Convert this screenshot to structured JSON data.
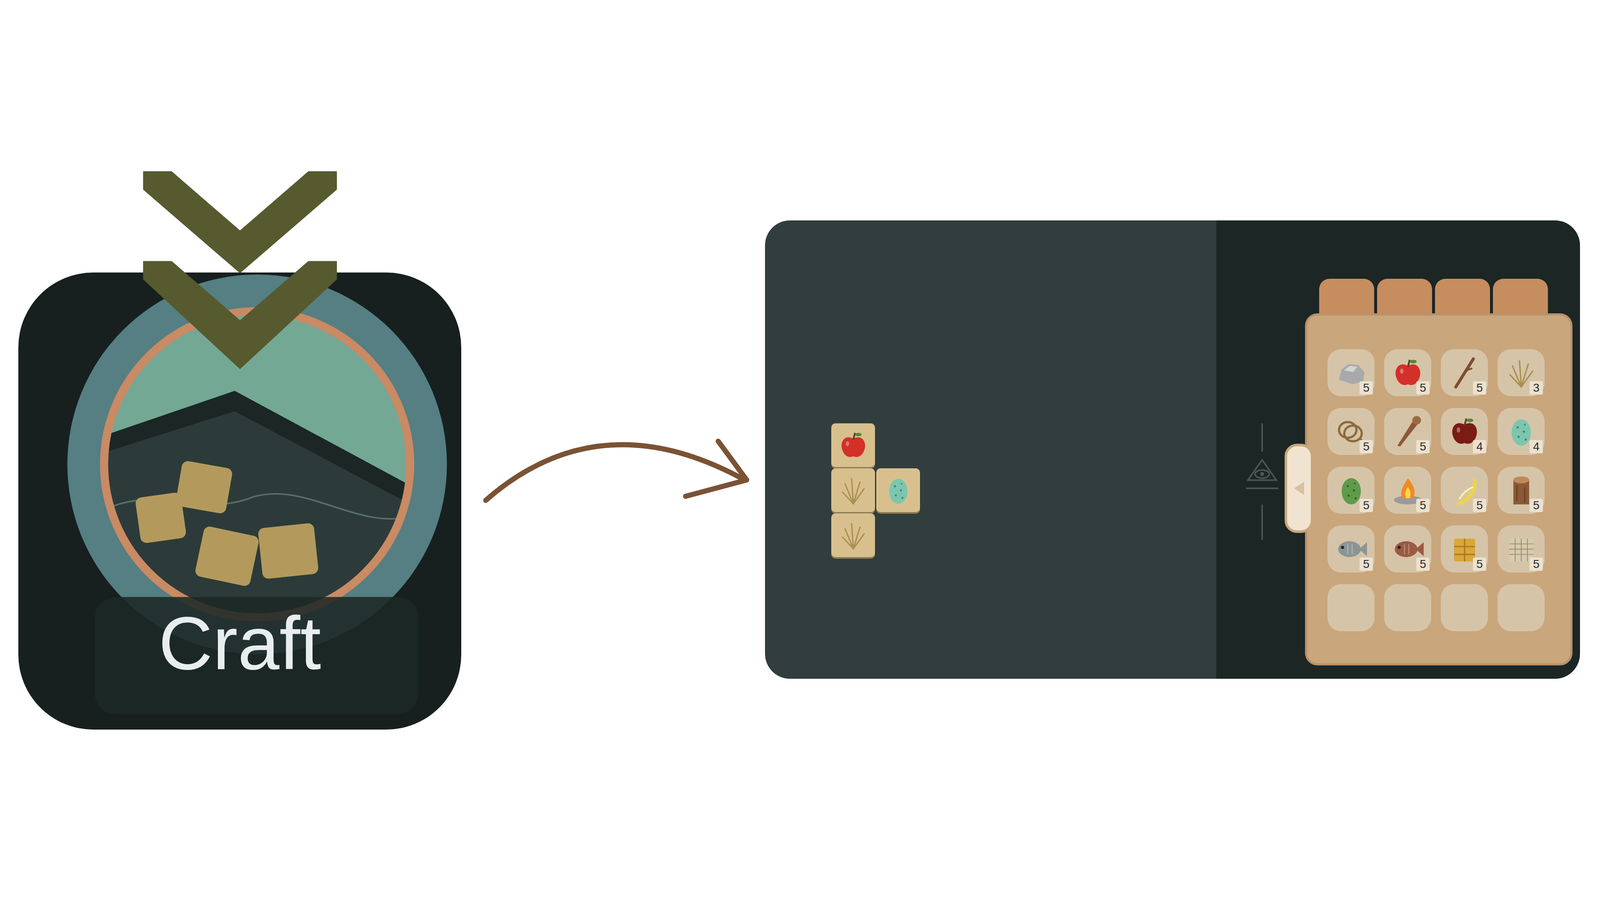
{
  "craft_button": {
    "label": "Craft"
  },
  "crafting_grid": {
    "rows": [
      [
        {
          "kind": "apple"
        },
        {
          "kind": "empty"
        }
      ],
      [
        {
          "kind": "grass"
        },
        {
          "kind": "blue_egg"
        }
      ],
      [
        {
          "kind": "grass"
        },
        {
          "kind": "empty"
        }
      ]
    ]
  },
  "inventory": {
    "tabs": [
      {
        "selected": false
      },
      {
        "selected": false
      },
      {
        "selected": false
      },
      {
        "selected": false
      }
    ],
    "slots": [
      {
        "kind": "stone",
        "count": "5"
      },
      {
        "kind": "apple",
        "count": "5"
      },
      {
        "kind": "stick",
        "count": "5"
      },
      {
        "kind": "grass",
        "count": "3"
      },
      {
        "kind": "rope",
        "count": "5"
      },
      {
        "kind": "club",
        "count": "5"
      },
      {
        "kind": "dark_apple",
        "count": "4"
      },
      {
        "kind": "blue_egg",
        "count": "4"
      },
      {
        "kind": "green_egg",
        "count": "5"
      },
      {
        "kind": "campfire",
        "count": "5"
      },
      {
        "kind": "banana",
        "count": "5"
      },
      {
        "kind": "log",
        "count": "5"
      },
      {
        "kind": "fish",
        "count": "5"
      },
      {
        "kind": "cooked_fish",
        "count": "5"
      },
      {
        "kind": "hay",
        "count": "5"
      },
      {
        "kind": "net",
        "count": "5"
      },
      {
        "kind": "empty"
      },
      {
        "kind": "empty"
      },
      {
        "kind": "empty"
      },
      {
        "kind": "empty"
      }
    ]
  }
}
